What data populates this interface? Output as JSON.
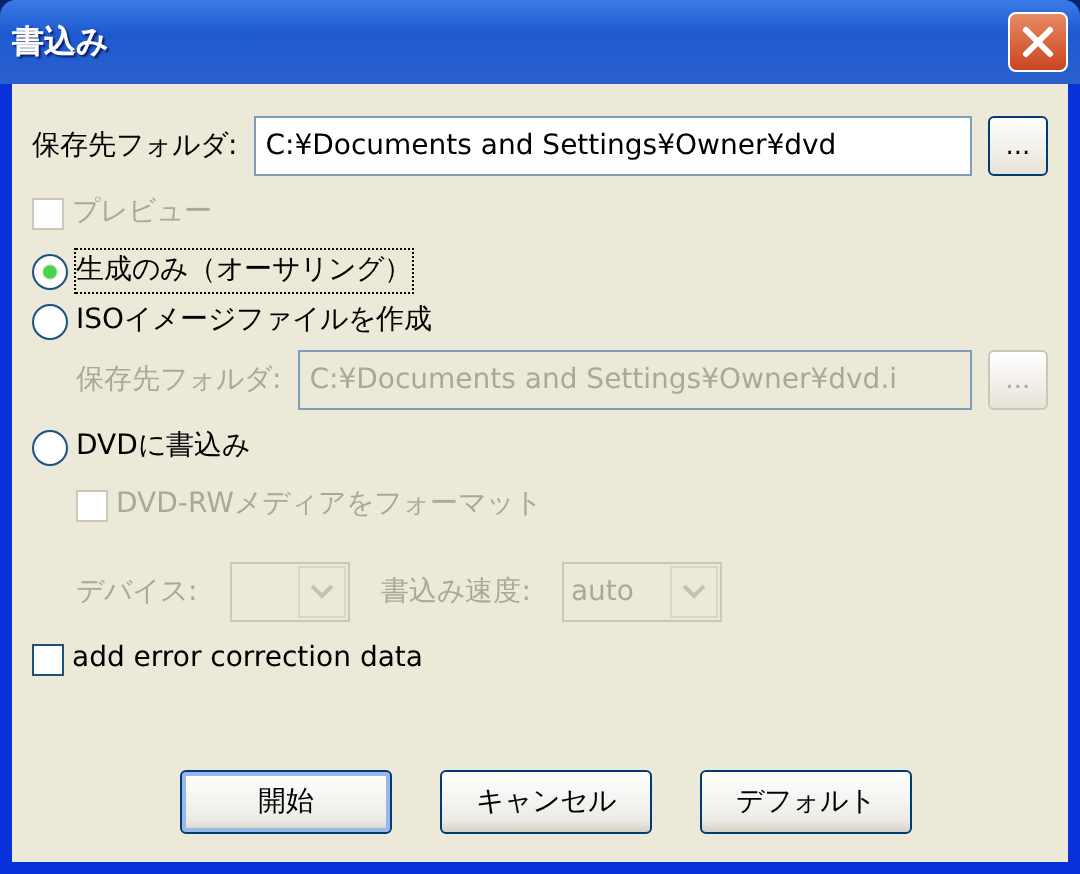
{
  "window": {
    "title": "書込み"
  },
  "output_folder": {
    "label": "保存先フォルダ:",
    "value": "C:¥Documents and Settings¥Owner¥dvd",
    "browse": "...",
    "disabled": false
  },
  "preview": {
    "label": "プレビュー",
    "checked": false,
    "disabled": true
  },
  "modes": [
    {
      "label": "生成のみ（オーサリング）",
      "selected": true,
      "focused": true
    },
    {
      "label": "ISOイメージファイルを作成",
      "selected": false,
      "focused": false
    },
    {
      "label": "DVDに書込み",
      "selected": false,
      "focused": false
    }
  ],
  "iso_folder": {
    "label": "保存先フォルダ:",
    "value": "C:¥Documents and Settings¥Owner¥dvd.i",
    "browse": "...",
    "disabled": true
  },
  "dvd_rw_format": {
    "label": "DVD-RWメディアをフォーマット",
    "checked": false,
    "disabled": true
  },
  "device": {
    "label": "デバイス:",
    "disabled": true
  },
  "speed": {
    "label": "書込み速度:",
    "value": "auto",
    "disabled": true
  },
  "error_correction": {
    "label": "add error correction data",
    "checked": false,
    "disabled": false
  },
  "buttons": [
    {
      "label": "開始",
      "default": true
    },
    {
      "label": "キャンセル",
      "default": false
    },
    {
      "label": "デフォルト",
      "default": false
    }
  ]
}
